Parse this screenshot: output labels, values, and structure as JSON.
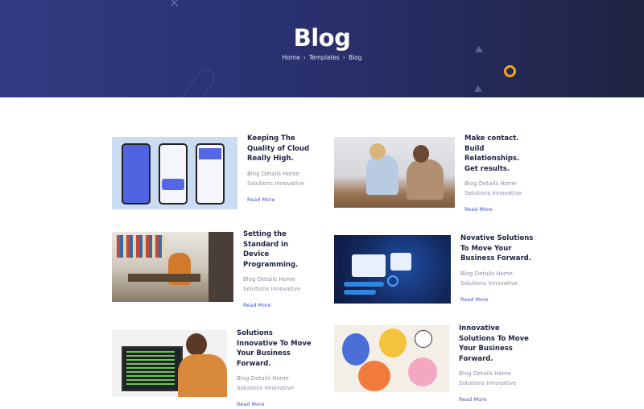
{
  "hero": {
    "title": "Blog",
    "breadcrumb": [
      "Home",
      "Templates",
      "Blog"
    ],
    "separator": "›"
  },
  "posts": [
    {
      "title": "Keeping The Quality of Cloud Really High.",
      "excerpt": "Blog Details Home Solutions Innovative",
      "read_more": "Read More",
      "image": "mobile-app-screens"
    },
    {
      "title": "Make contact. Build Relationships. Get results.",
      "excerpt": "Blog Details Home Solutions Innovative",
      "read_more": "Read More",
      "image": "office-colleagues"
    },
    {
      "title": "Setting the Standard in Device Programming.",
      "excerpt": "Blog Details Home Solutions Innovative",
      "read_more": "Read More",
      "image": "team-meeting"
    },
    {
      "title": "Novative Solutions To Move Your Business Forward.",
      "excerpt": "Blog Details Home Solutions Innovative",
      "read_more": "Read More",
      "image": "dashboard-illustration"
    },
    {
      "title": "Solutions Innovative To Move Your Business Forward.",
      "excerpt": "Blog Details Home Solutions Innovative",
      "read_more": "Read More",
      "image": "developer-coding"
    },
    {
      "title": "Innovative Solutions To Move Your Business Forward.",
      "excerpt": "Blog Details Home Solutions Innovative",
      "read_more": "Read More",
      "image": "people-illustration"
    }
  ],
  "colors": {
    "hero": "#2a3170",
    "accent": "#f2a71b",
    "link": "#4a55c9"
  }
}
